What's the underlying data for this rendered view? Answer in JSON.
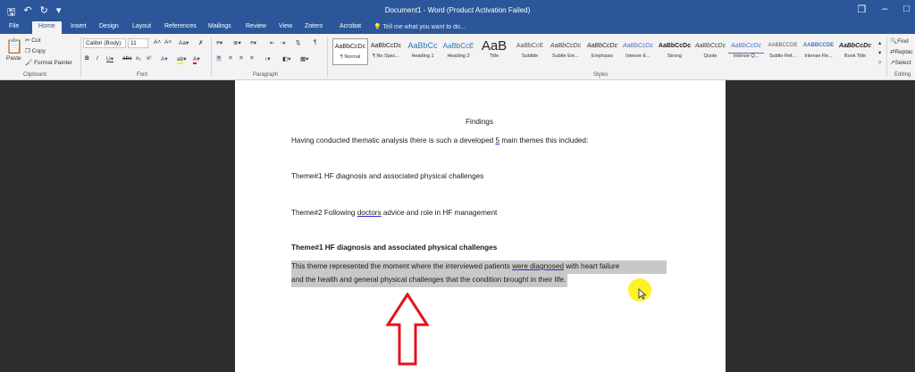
{
  "window": {
    "title": "Document1 - Word (Product Activation Failed)"
  },
  "tabs": [
    "File",
    "Home",
    "Insert",
    "Design",
    "Layout",
    "References",
    "Mailings",
    "Review",
    "View",
    "Zotero",
    "Acrobat"
  ],
  "active_tab": "Home",
  "tell_me": "Tell me what you want to do...",
  "clipboard": {
    "paste": "Paste",
    "cut": "Cut",
    "copy": "Copy",
    "format_painter": "Format Painter",
    "label": "Clipboard"
  },
  "font": {
    "name": "Calibri (Body)",
    "size": "11",
    "label": "Font"
  },
  "paragraph": {
    "label": "Paragraph"
  },
  "styles": {
    "label": "Styles",
    "items": [
      {
        "preview": "AaBbCcDc",
        "name": "¶ Normal"
      },
      {
        "preview": "AaBbCcDc",
        "name": "¶ No Spac..."
      },
      {
        "preview": "AaBbCc",
        "name": "Heading 1"
      },
      {
        "preview": "AaBbCcE",
        "name": "Heading 2"
      },
      {
        "preview": "AaB",
        "name": "Title"
      },
      {
        "preview": "AaBbCcE",
        "name": "Subtitle"
      },
      {
        "preview": "AaBbCcDc",
        "name": "Subtle Em..."
      },
      {
        "preview": "AaBbCcDc",
        "name": "Emphasis"
      },
      {
        "preview": "AaBbCcDc",
        "name": "Intense E..."
      },
      {
        "preview": "AaBbCcDc",
        "name": "Strong"
      },
      {
        "preview": "AaBbCcDc",
        "name": "Quote"
      },
      {
        "preview": "AaBbCcDc",
        "name": "Intense Q..."
      },
      {
        "preview": "AABBCCDE",
        "name": "Subtle Ref..."
      },
      {
        "preview": "AABBCCDE",
        "name": "Intense Re..."
      },
      {
        "preview": "AaBbCcDc",
        "name": "Book Title"
      }
    ]
  },
  "editing": {
    "find": "Find",
    "replace": "Replac",
    "select": "Select",
    "label": "Editing"
  },
  "document": {
    "heading": "Findings",
    "intro_before": "Having conducted thematic analysis there is such a developed ",
    "intro_num": "5",
    "intro_after": " main themes this included:",
    "theme1": "Theme#1 HF diagnosis and associated physical challenges",
    "theme2_before": "Theme#2 Following ",
    "theme2_word": "doctors",
    "theme2_after": " advice and role in HF management",
    "theme1_heading": "Theme#1 HF diagnosis and associated physical challenges",
    "para_line1_before": "This theme represented the moment where the interviewed patients ",
    "para_line1_under": "were diagnosed",
    "para_line1_after": " with heart failure",
    "para_line2": "and the health and general physical challenges that the condition brought in their life."
  },
  "colors": {
    "accent": "#2b579a",
    "annotation_arrow": "#e0141e",
    "cursor_highlight": "#fff000",
    "selection": "#c8c8c8"
  }
}
